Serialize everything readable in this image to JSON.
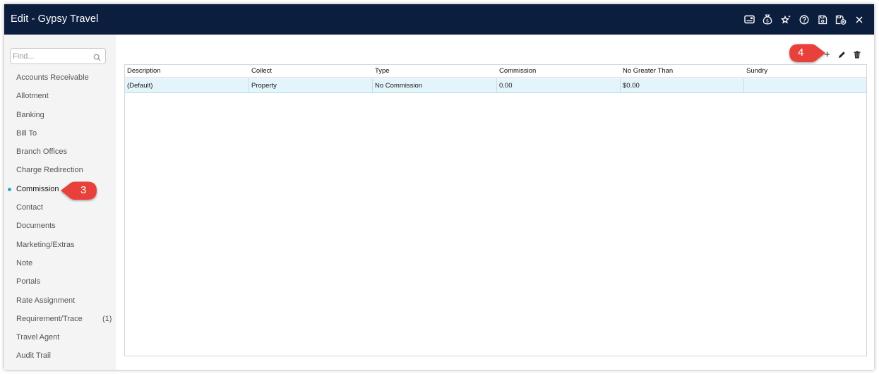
{
  "window": {
    "title": "Edit - Gypsy Travel",
    "title_icons": [
      "card-icon",
      "money-bag-icon",
      "star-sparkle-icon",
      "help-icon",
      "save-icon",
      "save-close-icon",
      "close-icon"
    ]
  },
  "sidebar": {
    "search": {
      "placeholder": "Find...",
      "value": ""
    },
    "items": [
      {
        "label": "Accounts Receivable"
      },
      {
        "label": "Allotment"
      },
      {
        "label": "Banking"
      },
      {
        "label": "Bill To"
      },
      {
        "label": "Branch Offices"
      },
      {
        "label": "Charge Redirection"
      },
      {
        "label": "Commission",
        "active": true
      },
      {
        "label": "Contact"
      },
      {
        "label": "Documents"
      },
      {
        "label": "Marketing/Extras"
      },
      {
        "label": "Note"
      },
      {
        "label": "Portals"
      },
      {
        "label": "Rate Assignment"
      },
      {
        "label": "Requirement/Trace",
        "count": "(1)"
      },
      {
        "label": "Travel Agent"
      },
      {
        "label": "Audit Trail"
      }
    ]
  },
  "toolbar": {
    "add_label": "+",
    "icons": [
      "add-icon",
      "edit-pencil-icon",
      "delete-trash-icon"
    ]
  },
  "grid": {
    "columns": [
      "Description",
      "Collect",
      "Type",
      "Commission",
      "No Greater Than",
      "Sundry"
    ],
    "rows": [
      [
        "(Default)",
        "Property",
        "No Commission",
        "0.00",
        "$0.00",
        ""
      ]
    ]
  },
  "callouts": [
    {
      "number": "3"
    },
    {
      "number": "4"
    }
  ],
  "colors": {
    "titlebar": "#0c1e3e",
    "sidebar_bg": "#f4f4f4",
    "active_dot": "#2ea6c8",
    "selected_row": "#e3f4fb",
    "callout_red": "#e8413a"
  }
}
